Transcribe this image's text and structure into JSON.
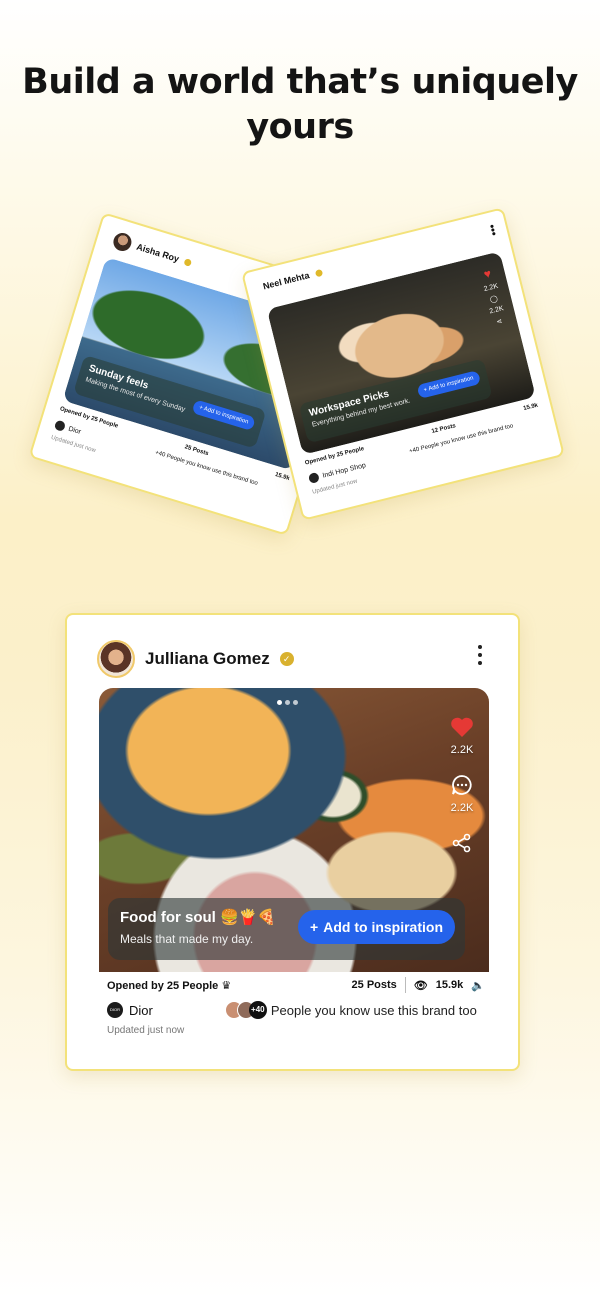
{
  "headline": {
    "line1": "Build a world that’s uniquely",
    "line2": "yours"
  },
  "card_aisha": {
    "name": "Aisha Roy",
    "title": "Sunday feels",
    "subtitle": "Making the most of every Sunday",
    "button": "Add to inspiration",
    "opened_by": "Opened by 25 People",
    "brand": "Dior",
    "updated": "Updated just now",
    "posts": "25 Posts",
    "views": "15.9k",
    "friends_text": "People you know use this brand too",
    "friends_more": "+40"
  },
  "card_neel": {
    "name": "Neel Mehta",
    "title": "Workspace Picks",
    "subtitle": "Everything behind my best work.",
    "button": "Add to inspiration",
    "opened_by": "Opened by 25 People",
    "brand": "Indi Hop Shop",
    "updated": "Updated just now",
    "posts": "12 Posts",
    "views": "15.9k",
    "likes": "2.2K",
    "comments": "2.2K",
    "friends_text": "People you know use this brand too",
    "friends_more": "+40"
  },
  "main_card": {
    "name": "Julliana Gomez",
    "verified_mark": "✓",
    "title": "Food for soul 🍔🍟🍕",
    "subtitle": "Meals that made my day.",
    "button": "Add to inspiration",
    "likes": "2.2K",
    "comments": "2.2K",
    "opened_by": "Opened by 25 People",
    "posts": "25 Posts",
    "views": "15.9k",
    "brand": "Dior",
    "brand_logo_text": "DIOR",
    "friends_more": "+40",
    "friends_text": "People you know use this brand too",
    "updated": "Updated just now"
  },
  "colors": {
    "accent": "#2563eb",
    "heart": "#e53935",
    "card_border": "#f3e27a",
    "verified": "#d9b12e"
  }
}
